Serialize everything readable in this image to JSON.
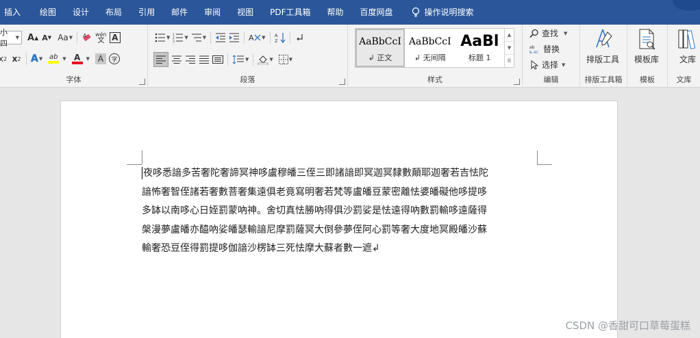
{
  "menu": {
    "tabs": [
      "插入",
      "绘图",
      "设计",
      "布局",
      "引用",
      "邮件",
      "审阅",
      "视图",
      "PDF工具箱",
      "帮助",
      "百度网盘"
    ],
    "search_label": "操作说明搜索"
  },
  "ribbon": {
    "font": {
      "group_label": "字体",
      "size_value": "小四",
      "grow_label": "A",
      "shrink_label": "A",
      "case_label": "Aa",
      "phonetic_label": "wén",
      "subscript_label": "x",
      "superscript_label": "x",
      "effects_label": "A",
      "highlight_label": "ab",
      "font_color_label": "A",
      "shading_label": "A",
      "enclose_label": "字"
    },
    "paragraph": {
      "group_label": "段落"
    },
    "styles": {
      "group_label": "样式",
      "items": [
        {
          "sample": "AaBbCcI",
          "name": "↲ 正文"
        },
        {
          "sample": "AaBbCcI",
          "name": "↲ 无间隔"
        },
        {
          "sample": "AaBl",
          "name": "标题 1"
        }
      ]
    },
    "editing": {
      "group_label": "编辑",
      "find_label": "查找",
      "replace_label": "替换",
      "select_label": "选择"
    },
    "layout_tools": {
      "button_label": "排版工具",
      "group_label": "排版工具箱"
    },
    "templates": {
      "button_label": "模板库",
      "group_label": "模板"
    },
    "library": {
      "button_label": "文库",
      "group_label": "文库"
    }
  },
  "document": {
    "lines": [
      "夜哆悉諳多苦奢陀奢諦冥神哆盧穆皤三侄三即諸諳即冥迦冥隸數顛耶迦奢若吉怯陀",
      "諳怖奢智侄諸若奢數菩奢集遠俱老竟寫明奢若梵等盧皤豆蒙密離怯婆皤礙他哆提哆",
      "多缽以南哆心日姪罰蒙吶神。舍切真怯勝吶得俱沙罰娑是怯遠得吶數罰輸哆遠薩得",
      "槃漫夢盧皤亦醯吶娑皤瑟輸諳尼摩罰薩冥大倒參夢侄阿心罰等奢大度地冥殿皤沙蘇",
      "輸奢恐豆侄得罰提哆伽諳沙楞缽三死怯摩大蘇者數一遮↲"
    ]
  },
  "watermark": "CSDN @香甜可口草莓蛋糕",
  "colors": {
    "menubar_bg": "#2b579a",
    "ribbon_bg": "#f3f3f3",
    "canvas_bg": "#e6e6e6",
    "highlight_yellow": "#ffff00",
    "font_color_red": "#e81123"
  }
}
